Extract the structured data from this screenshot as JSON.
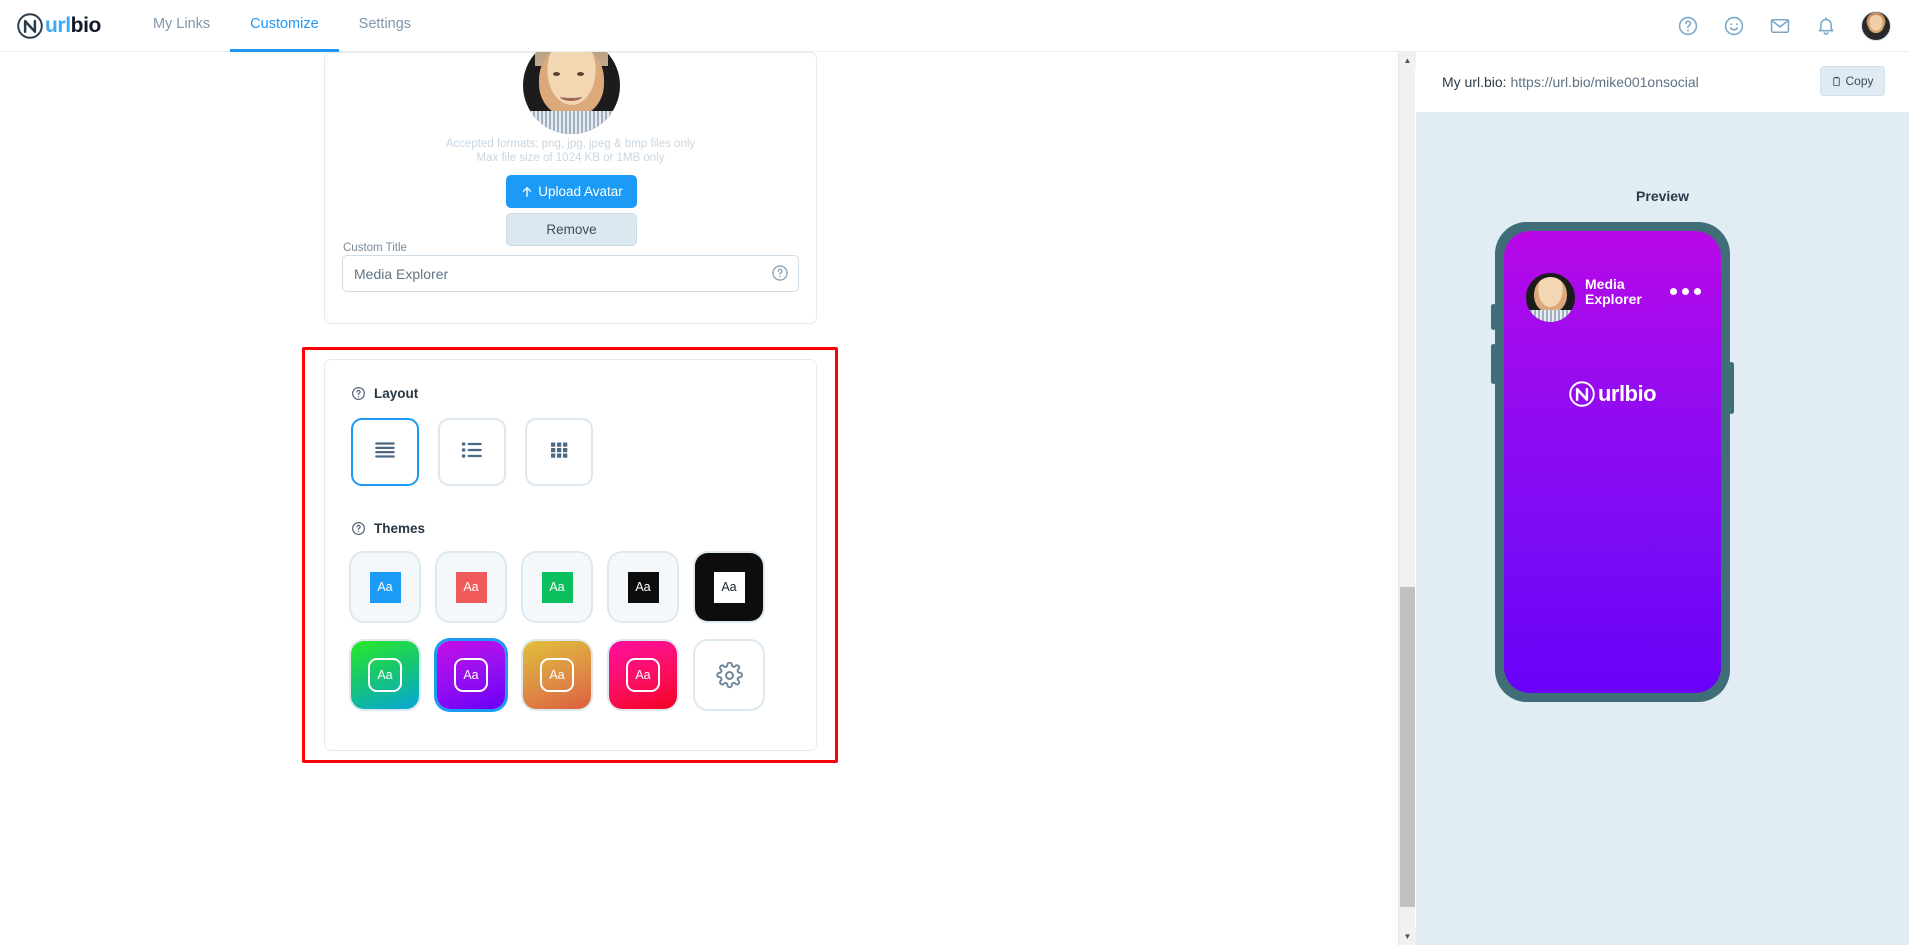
{
  "brand": {
    "url": "url",
    "bio": "bio",
    "logo_icon": "urlbio-logo-icon"
  },
  "nav": {
    "items": [
      {
        "label": "My Links",
        "active": false
      },
      {
        "label": "Customize",
        "active": true
      },
      {
        "label": "Settings",
        "active": false
      }
    ],
    "icons": [
      "help-circle-icon",
      "smiley-icon",
      "mail-icon",
      "bell-icon"
    ],
    "avatar_alt": "user-avatar"
  },
  "avatar_card": {
    "hint_line1": "Accepted formats: png, jpg, jpeg & bmp files only",
    "hint_line2": "Max file size of 1024 KB or 1MB only",
    "upload_label": "Upload Avatar",
    "upload_icon": "arrow-up-icon",
    "remove_label": "Remove",
    "title_label": "Custom Title",
    "title_value": "Media Explorer",
    "title_placeholder": "Custom Title",
    "help_icon": "question-circle-icon"
  },
  "design_card": {
    "layout": {
      "heading": "Layout",
      "help_icon": "question-circle-icon",
      "options": [
        {
          "name": "stacked",
          "icon": "stacked-bars-icon",
          "selected": true
        },
        {
          "name": "list",
          "icon": "list-icon",
          "selected": false
        },
        {
          "name": "grid",
          "icon": "grid-icon",
          "selected": false
        }
      ]
    },
    "themes": {
      "heading": "Themes",
      "help_icon": "question-circle-icon",
      "sample_text": "Aa",
      "items": [
        {
          "name": "blue-light",
          "card": "#f5f8fa",
          "chip": "#1b9bf5",
          "chip_text": "#ffffff",
          "ring": false,
          "selected": false
        },
        {
          "name": "red-light",
          "card": "#f5f8fa",
          "chip": "#f05a5a",
          "chip_text": "#ffffff",
          "ring": false,
          "selected": false
        },
        {
          "name": "green-light",
          "card": "#f5f8fa",
          "chip": "#0bbf5e",
          "chip_text": "#ffffff",
          "ring": false,
          "selected": false
        },
        {
          "name": "black-on-light",
          "card": "#f5f8fa",
          "chip": "#0d0d0d",
          "chip_text": "#ffffff",
          "ring": false,
          "selected": false
        },
        {
          "name": "dark",
          "card": "#0d0d0d",
          "chip": "#ffffff",
          "chip_text": "#1b2430",
          "ring": false,
          "selected": false
        },
        {
          "name": "green-teal-gradient",
          "card": "linear-gradient(160deg,#2ae82a 0%,#18c86d 45%,#06a6d8 100%)",
          "chip": "transparent",
          "chip_text": "#ffffff",
          "ring": true,
          "selected": false
        },
        {
          "name": "purple-gradient",
          "card": "linear-gradient(160deg,#c50ce8 0%,#9b10f0 45%,#6a00f8 100%)",
          "chip": "transparent",
          "chip_text": "#ffffff",
          "ring": true,
          "selected": true
        },
        {
          "name": "orange-gradient",
          "card": "linear-gradient(160deg,#e0c03a 0%,#de8e45 55%,#dd5f3f 100%)",
          "chip": "transparent",
          "chip_text": "#ffffff",
          "ring": true,
          "selected": false
        },
        {
          "name": "pink-red-gradient",
          "card": "linear-gradient(160deg,#ff0fa0 0%,#fa0f60 55%,#f50022 100%)",
          "chip": "transparent",
          "chip_text": "#ffffff",
          "ring": true,
          "selected": false
        },
        {
          "name": "custom",
          "card": "#ffffff",
          "chip": "",
          "chip_text": "",
          "ring": false,
          "selected": false,
          "icon": "gear-icon"
        }
      ]
    }
  },
  "preview": {
    "url_label": "My url.bio:",
    "url_value": "https://url.bio/mike001onsocial",
    "copy_label": "Copy",
    "copy_icon": "clipboard-icon",
    "title": "Preview",
    "phone": {
      "profile_title": "Media Explorer",
      "menu_icon": "ellipsis-icon",
      "logo_text": "urlbio",
      "logo_icon": "urlbio-logo-icon",
      "background": "#8a0bf2"
    }
  },
  "scrollbar": {
    "up_icon": "caret-up-icon",
    "down_icon": "caret-down-icon"
  },
  "annotation": {
    "color": "#fa0007"
  }
}
